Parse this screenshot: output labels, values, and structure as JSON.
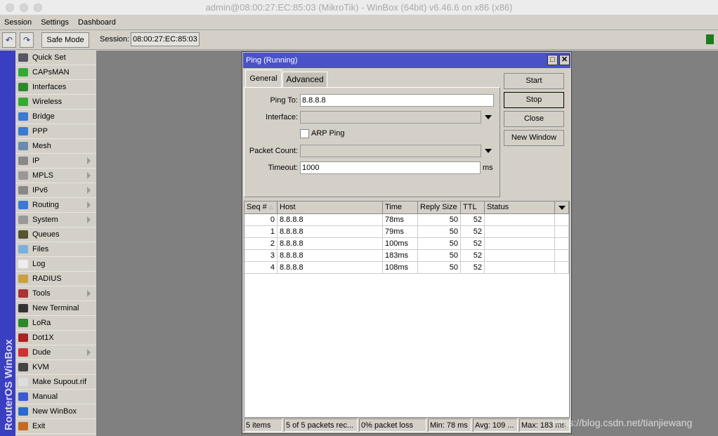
{
  "window_title": "admin@08:00:27:EC:85:03 (MikroTik) - WinBox (64bit) v6.46.6 on x86 (x86)",
  "menu": [
    "Session",
    "Settings",
    "Dashboard"
  ],
  "toolbar": {
    "undo_icon": "undo-icon",
    "redo_icon": "redo-icon",
    "safe_mode": "Safe Mode",
    "session_label": "Session:",
    "session_value": "08:00:27:EC:85:03",
    "status_color": "#1e7a1e"
  },
  "sidebar": {
    "brand": "RouterOS WinBox",
    "items": [
      {
        "label": "Quick Set",
        "icon": "wand-icon",
        "color": "#556"
      },
      {
        "label": "CAPsMAN",
        "icon": "antenna-icon",
        "color": "#3a3"
      },
      {
        "label": "Interfaces",
        "icon": "nic-icon",
        "color": "#2a8a2a"
      },
      {
        "label": "Wireless",
        "icon": "wireless-icon",
        "color": "#3a3"
      },
      {
        "label": "Bridge",
        "icon": "bridge-icon",
        "color": "#3a7ad0"
      },
      {
        "label": "PPP",
        "icon": "ppp-icon",
        "color": "#3a7ad0"
      },
      {
        "label": "Mesh",
        "icon": "mesh-icon",
        "color": "#6a8ab0"
      },
      {
        "label": "IP",
        "icon": "ip-icon",
        "color": "#888",
        "sub": true
      },
      {
        "label": "MPLS",
        "icon": "mpls-icon",
        "color": "#999",
        "sub": true
      },
      {
        "label": "IPv6",
        "icon": "ipv6-icon",
        "color": "#888",
        "sub": true
      },
      {
        "label": "Routing",
        "icon": "routing-icon",
        "color": "#3a7ad0",
        "sub": true
      },
      {
        "label": "System",
        "icon": "gear-icon",
        "color": "#999",
        "sub": true
      },
      {
        "label": "Queues",
        "icon": "queues-icon",
        "color": "#553"
      },
      {
        "label": "Files",
        "icon": "folder-icon",
        "color": "#7ab0e0"
      },
      {
        "label": "Log",
        "icon": "log-icon",
        "color": "#eee"
      },
      {
        "label": "RADIUS",
        "icon": "radius-icon",
        "color": "#c8a040"
      },
      {
        "label": "Tools",
        "icon": "tools-icon",
        "color": "#a33",
        "sub": true
      },
      {
        "label": "New Terminal",
        "icon": "terminal-icon",
        "color": "#333"
      },
      {
        "label": "LoRa",
        "icon": "lora-icon",
        "color": "#2a8a2a"
      },
      {
        "label": "Dot1X",
        "icon": "dot1x-icon",
        "color": "#a22"
      },
      {
        "label": "Dude",
        "icon": "dude-icon",
        "color": "#c33",
        "sub": true
      },
      {
        "label": "KVM",
        "icon": "kvm-icon",
        "color": "#444"
      },
      {
        "label": "Make Supout.rif",
        "icon": "supout-icon",
        "color": "#ddd"
      },
      {
        "label": "Manual",
        "icon": "help-icon",
        "color": "#3a5ad0"
      },
      {
        "label": "New WinBox",
        "icon": "winbox-icon",
        "color": "#2a6ad0"
      },
      {
        "label": "Exit",
        "icon": "exit-icon",
        "color": "#c86a20"
      }
    ]
  },
  "ping": {
    "title": "Ping (Running)",
    "tabs": [
      "General",
      "Advanced"
    ],
    "ping_to_label": "Ping To:",
    "ping_to": "8.8.8.8",
    "interface_label": "Interface:",
    "interface": "",
    "arp_ping_label": "ARP Ping",
    "arp_ping": false,
    "packet_count_label": "Packet Count:",
    "packet_count": "",
    "timeout_label": "Timeout:",
    "timeout": "1000",
    "timeout_unit": "ms",
    "buttons": [
      "Start",
      "Stop",
      "Close",
      "New Window"
    ],
    "columns": [
      "Seq #",
      "Host",
      "Time",
      "Reply Size",
      "TTL",
      "Status"
    ],
    "rows": [
      [
        "0",
        "8.8.8.8",
        "78ms",
        "50",
        "52",
        ""
      ],
      [
        "1",
        "8.8.8.8",
        "79ms",
        "50",
        "52",
        ""
      ],
      [
        "2",
        "8.8.8.8",
        "100ms",
        "50",
        "52",
        ""
      ],
      [
        "3",
        "8.8.8.8",
        "183ms",
        "50",
        "52",
        ""
      ],
      [
        "4",
        "8.8.8.8",
        "108ms",
        "50",
        "52",
        ""
      ]
    ],
    "status": [
      "5 items",
      "5 of 5 packets rec...",
      "0% packet loss",
      "Min: 78 ms",
      "Avg: 109 ...",
      "Max: 183 ms"
    ]
  },
  "watermark": "https://blog.csdn.net/tianjiewang"
}
